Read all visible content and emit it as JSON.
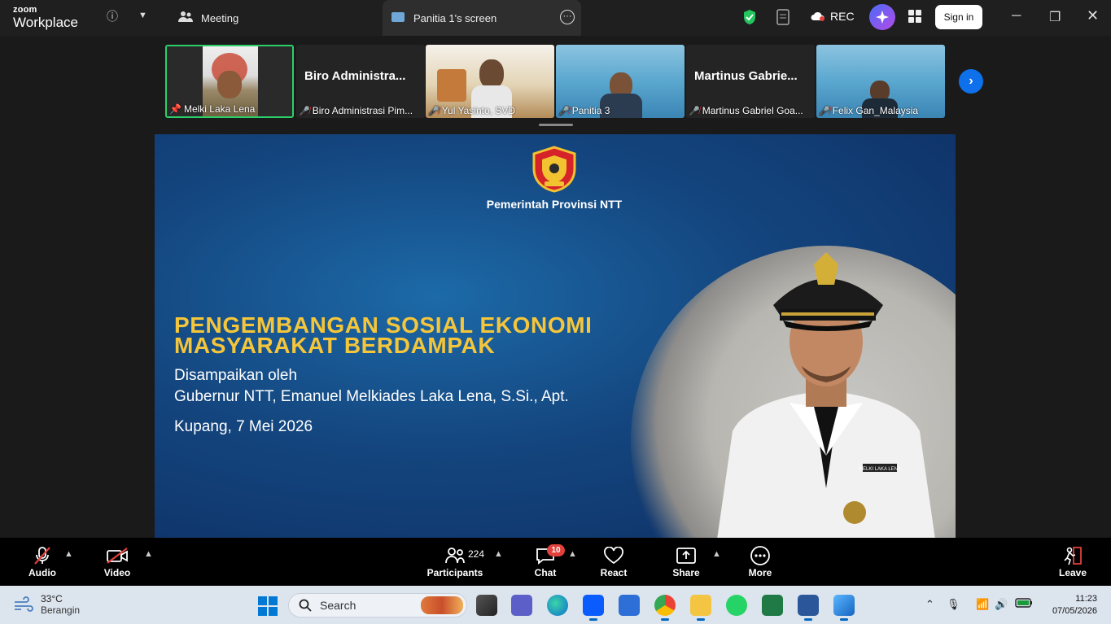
{
  "titlebar": {
    "logo_line1": "zoom",
    "logo_line2": "Workplace",
    "tabs": [
      {
        "label": "Meeting"
      },
      {
        "label": "Panitia 1's screen"
      }
    ],
    "rec_label": "REC",
    "signin_label": "Sign in"
  },
  "participants_strip": {
    "tiles": [
      {
        "name": "Melki Laka Lena",
        "big_name": "",
        "muted": false,
        "pinned": true
      },
      {
        "name": "Biro Administrasi Pim...",
        "big_name": "Biro Administra...",
        "muted": true
      },
      {
        "name": "Yul Yasinto, SVD",
        "big_name": "",
        "muted": true
      },
      {
        "name": "Panitia 3",
        "big_name": "",
        "muted": true
      },
      {
        "name": "Martinus Gabriel Goa...",
        "big_name": "Martinus Gabrie...",
        "muted": true
      },
      {
        "name": "Felix Gan_Malaysia",
        "big_name": "",
        "muted": true
      }
    ]
  },
  "shared_screen": {
    "org": "Pemerintah Provinsi NTT",
    "headline_line1": "PENGEMBANGAN SOSIAL EKONOMI",
    "headline_line2": "MASYARAKAT BERDAMPAK",
    "presented_by": "Disampaikan oleh",
    "presenter": "Gubernur NTT, Emanuel Melkiades Laka Lena, S.Si., Apt.",
    "place_date": "Kupang, 7 Mei 2026",
    "name_tag": "MELKI LAKA LENA"
  },
  "toolbar": {
    "audio": "Audio",
    "video": "Video",
    "participants": "Participants",
    "participants_count": "224",
    "chat": "Chat",
    "chat_badge": "10",
    "react": "React",
    "share": "Share",
    "more": "More",
    "leave": "Leave"
  },
  "taskbar": {
    "temperature": "33°C",
    "weather": "Berangin",
    "search_placeholder": "Search",
    "time": "11:23",
    "date": "07/05/2026"
  },
  "colors": {
    "active_border": "#2ccf6a",
    "accent_blue": "#0e71eb",
    "headline_yellow": "#f6c63a",
    "mute_red": "#e0413b"
  }
}
